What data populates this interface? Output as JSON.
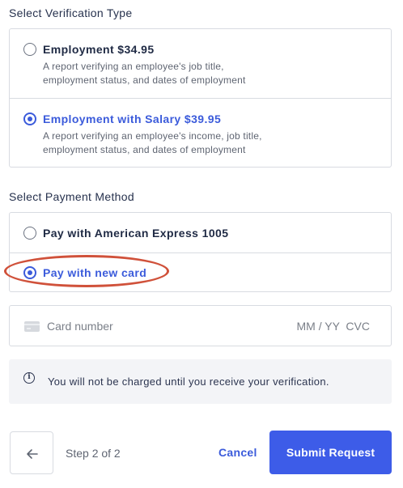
{
  "verification": {
    "title": "Select Verification Type",
    "options": [
      {
        "label": "Employment $34.95",
        "desc_line1": "A report verifying an employee's job title,",
        "desc_line2": "employment status, and dates of employment",
        "selected": false
      },
      {
        "label": "Employment with Salary $39.95",
        "desc_line1": "A report verifying an employee's income, job title,",
        "desc_line2": "employment status, and dates of employment",
        "selected": true
      }
    ]
  },
  "payment": {
    "title": "Select Payment Method",
    "options": [
      {
        "label": "Pay with American Express 1005",
        "selected": false
      },
      {
        "label": "Pay with new card",
        "selected": true
      }
    ],
    "card_number_placeholder": "Card number",
    "expiry_cvc_placeholder": "MM / YY  CVC"
  },
  "notice": {
    "icon": "info-icon",
    "text": "You will not be charged until you receive your verification."
  },
  "footer": {
    "back_icon": "arrow-left-icon",
    "step_text": "Step 2 of 2",
    "cancel_label": "Cancel",
    "submit_label": "Submit Request"
  },
  "colors": {
    "accent": "#3b5bdb",
    "submit_bg": "#3d5ce8",
    "annotation": "#d0513a",
    "border": "#d8dbe1",
    "notice_bg": "#f3f4f7"
  }
}
